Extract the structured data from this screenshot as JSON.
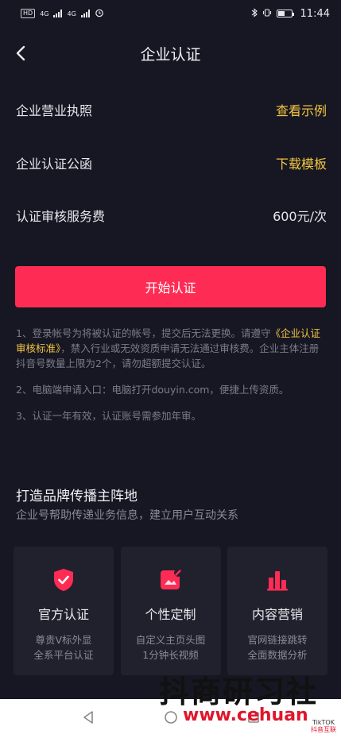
{
  "status_bar": {
    "sim1": "HD",
    "sim2": "4G",
    "sim3": "4G",
    "time": "11:44"
  },
  "nav": {
    "title": "企业认证",
    "back_icon": "chevron-left-icon"
  },
  "rows": [
    {
      "label": "企业营业执照",
      "action": "查看示例"
    },
    {
      "label": "企业认证公函",
      "action": "下载模板"
    },
    {
      "label": "认证审核服务费",
      "value": "600元/次"
    }
  ],
  "start_button": "开始认证",
  "notes": {
    "n1_pre": "1、登录帐号为将被认证的帐号，提交后无法更换。请遵守",
    "n1_link": "《企业认证审核标准》",
    "n1_post": "，禁入行业或无效资质申请无法通过审核费。企业主体注册抖音号数量上限为2个，请勿超额提交认证。",
    "n2": "2、电脑端申请入口：电脑打开douyin.com，便捷上传资质。",
    "n3": "3、认证一年有效，认证账号需参加年审。"
  },
  "section": {
    "title": "打造品牌传播主阵地",
    "subtitle": "企业号帮助传递业务信息，建立用户互动关系"
  },
  "cards": [
    {
      "icon": "shield-check-icon",
      "title": "官方认证",
      "line1": "尊贵V标外显",
      "line2": "全系平台认证"
    },
    {
      "icon": "customize-icon",
      "title": "个性定制",
      "line1": "自定义主页头图",
      "line2": "1分钟长视频"
    },
    {
      "icon": "bar-chart-icon",
      "title": "内容营销",
      "line1": "官网链接跳转",
      "line2": "全面数据分析"
    }
  ],
  "watermark": {
    "text": "抖商研习社",
    "url": "www.cehuan",
    "badge_line1": "TikTOK",
    "badge_line2": "抖音互联"
  },
  "colors": {
    "accent": "#fe2c55",
    "link": "#f4c543",
    "background": "#161722",
    "card": "#20212c"
  }
}
